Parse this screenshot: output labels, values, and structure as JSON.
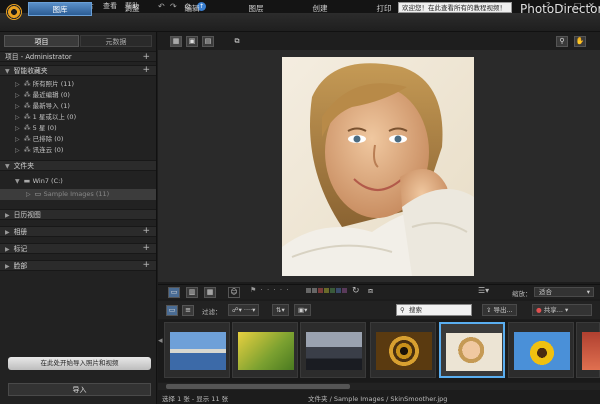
{
  "menu": {
    "items": [
      "文件",
      "编辑",
      "照片",
      "查看",
      "帮助"
    ]
  },
  "notice_text": "欢迎您！在此查看所有的教程视频！",
  "brand": "PhotoDirector",
  "modules": {
    "tabs": [
      "图库",
      "调整",
      "编辑",
      "图层",
      "创建",
      "打印"
    ]
  },
  "left": {
    "subtabs": [
      "项目",
      "元数据"
    ],
    "project_label": "项目 - Administrator",
    "smart_collections": {
      "title": "智能收藏夹",
      "items": [
        "所有照片 (11)",
        "最近编辑 (0)",
        "最新导入 (1)",
        "1 星或以上 (0)",
        "5 星 (0)",
        "已排除 (0)",
        "讯连云 (0)"
      ]
    },
    "folders": {
      "title": "文件夹",
      "drive": "Win7 (C:)",
      "subfolder": "Sample Images (11)"
    },
    "calendar": "日历视图",
    "albums": "相册",
    "tags": "标记",
    "faces": "脸部",
    "import_tip": "在此处开始导入照片和视频",
    "import_button": "导入"
  },
  "filter": {
    "label": "过滤：",
    "search_placeholder": "搜索",
    "export": "导出...",
    "share": "共享..."
  },
  "zoom": {
    "label": "缩放：",
    "value": "适合"
  },
  "status": {
    "selection": "选择 1 张 - 显示 11 张",
    "path": "文件夹 / Sample Images / SkinSmoother.jpg"
  },
  "colors": {
    "accent": "#5aaef0",
    "active_tab": "#3a72b0"
  }
}
